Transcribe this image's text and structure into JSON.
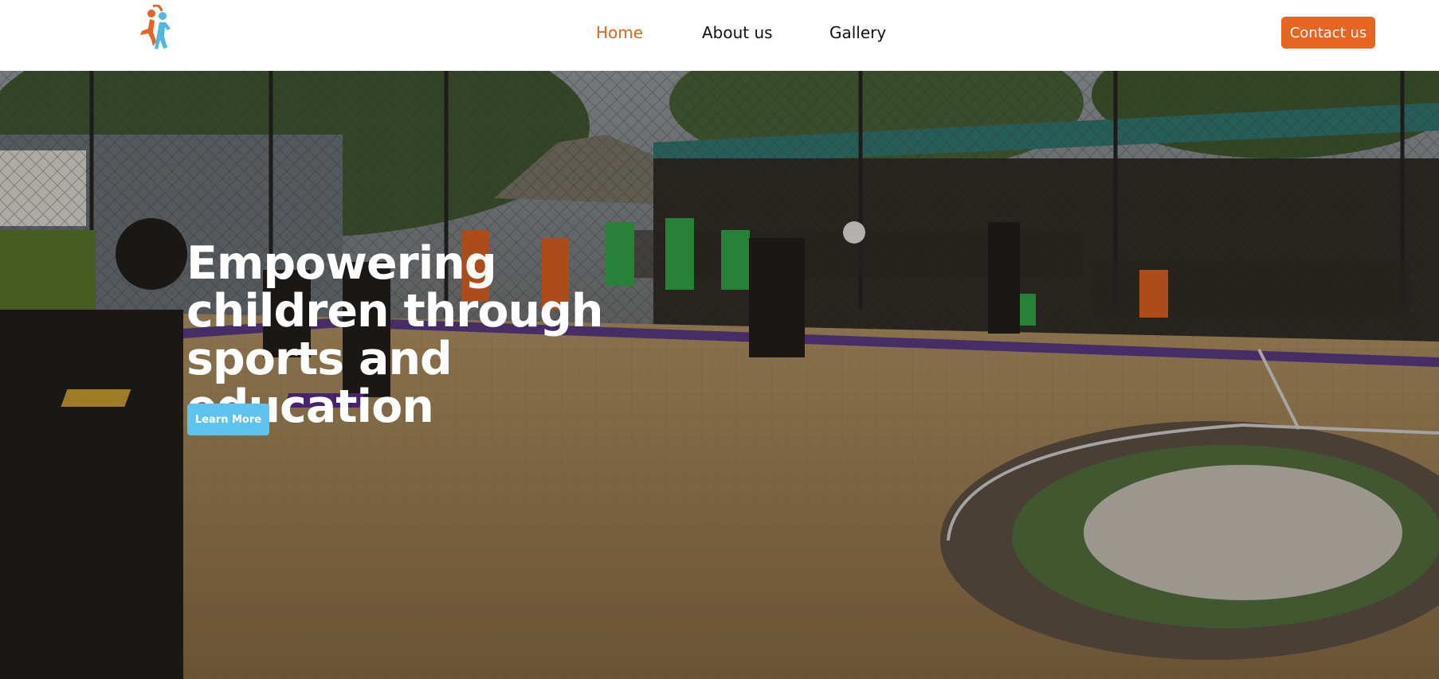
{
  "header": {
    "logo_icon": "kids-beyond-limit-logo-icon",
    "nav": [
      {
        "label": "Home",
        "active": true
      },
      {
        "label": "About us",
        "active": false
      },
      {
        "label": "Gallery",
        "active": false
      }
    ],
    "contact_label": "Contact us"
  },
  "hero": {
    "title": "Empowering children through sports and education",
    "cta_label": "Learn More",
    "image": "handball-court-photo"
  },
  "colors": {
    "accent": "#e8641f",
    "cta": "#5cc4ee",
    "logo_blue": "#4fb7e4"
  }
}
